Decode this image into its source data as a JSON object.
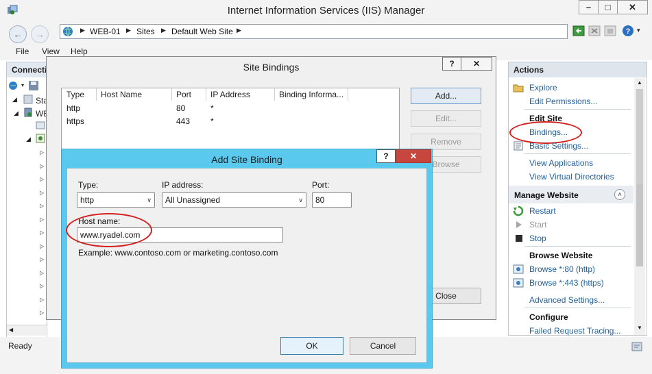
{
  "window": {
    "title": "Internet Information Services (IIS) Manager",
    "minimize": "–",
    "maximize": "□",
    "close": "✕",
    "back": "←",
    "forward": "→"
  },
  "breadcrumb": [
    "WEB-01",
    "Sites",
    "Default Web Site"
  ],
  "breadcrumb_sep": "▶",
  "menu": [
    "File",
    "View",
    "Help"
  ],
  "connections": {
    "header": "Connecti",
    "tree_fragments": [
      "Sta",
      "WE"
    ]
  },
  "actions": {
    "header": "Actions",
    "explore": "Explore",
    "edit_permissions": "Edit Permissions...",
    "edit_site_header": "Edit Site",
    "bindings": "Bindings...",
    "basic_settings": "Basic Settings...",
    "view_applications": "View Applications",
    "view_virtual_directories": "View Virtual Directories",
    "manage_website_header": "Manage Website",
    "restart": "Restart",
    "start": "Start",
    "stop": "Stop",
    "browse_website_header": "Browse Website",
    "browse_80": "Browse *:80 (http)",
    "browse_443": "Browse *:443 (https)",
    "advanced_settings": "Advanced Settings...",
    "configure_header": "Configure",
    "failed_request_tracing": "Failed Request Tracing...",
    "collapse_glyph": "˄"
  },
  "status_bar": {
    "text": "Ready"
  },
  "site_bindings": {
    "title": "Site Bindings",
    "help": "?",
    "close": "✕",
    "columns": [
      "Type",
      "Host Name",
      "Port",
      "IP Address",
      "Binding Informa..."
    ],
    "rows": [
      {
        "type": "http",
        "host": "",
        "port": "80",
        "ip": "*",
        "info": ""
      },
      {
        "type": "https",
        "host": "",
        "port": "443",
        "ip": "*",
        "info": ""
      }
    ],
    "buttons": {
      "add": "Add...",
      "edit": "Edit...",
      "remove": "Remove",
      "browse": "Browse",
      "close": "Close"
    }
  },
  "add_site_binding": {
    "title": "Add Site Binding",
    "help": "?",
    "close": "✕",
    "type_label": "Type:",
    "type_value": "http",
    "ip_label": "IP address:",
    "ip_value": "All Unassigned",
    "port_label": "Port:",
    "port_value": "80",
    "host_label": "Host name:",
    "host_value": "www.ryadel.com",
    "example": "Example: www.contoso.com or marketing.contoso.com",
    "ok": "OK",
    "cancel": "Cancel",
    "dropdown_glyph": "∨"
  },
  "colors": {
    "dialog_frame": "#5bc8ee",
    "close_red": "#c7463e",
    "link_blue": "#1f5f9c",
    "annotation_red": "#d41f1f"
  }
}
